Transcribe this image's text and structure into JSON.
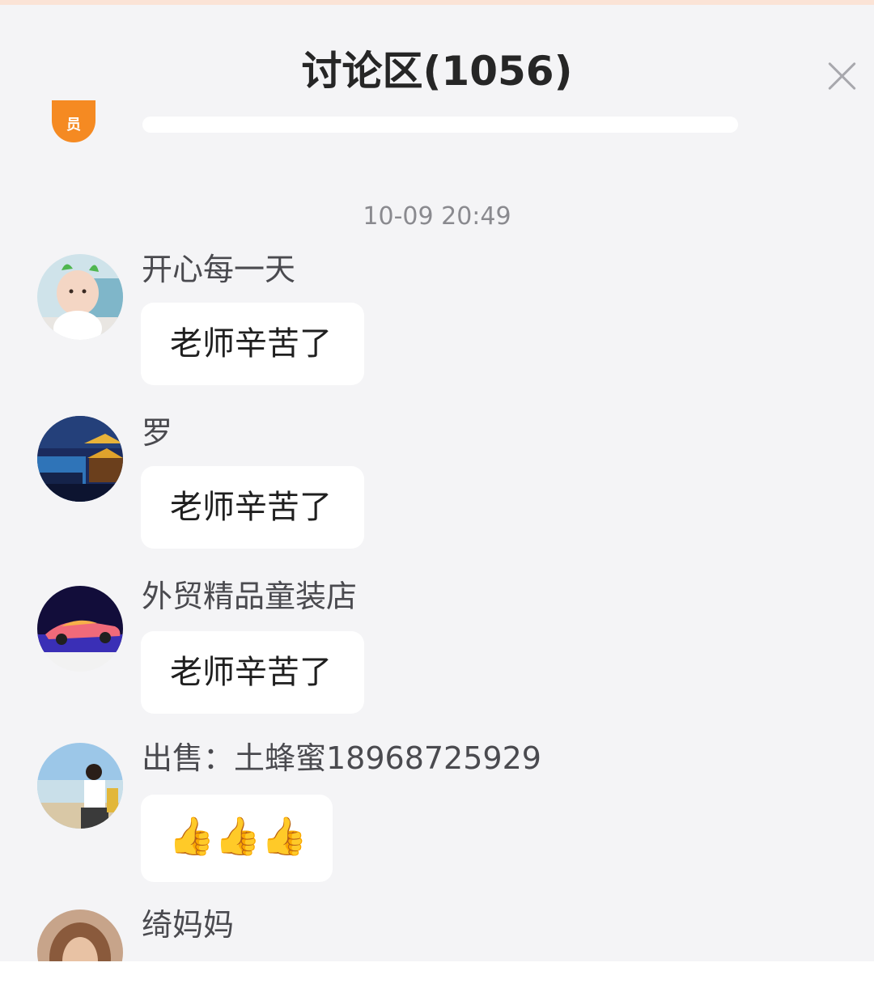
{
  "header": {
    "title": "讨论区(1056)",
    "close_icon": "close-icon"
  },
  "previous_message": {
    "avatar_text": "员"
  },
  "timestamp": "10-09 20:49",
  "messages": [
    {
      "username": "开心每一天",
      "text": "老师辛苦了",
      "avatar": "baby-photo-avatar"
    },
    {
      "username": "罗",
      "text": "老师辛苦了",
      "avatar": "night-pavilion-avatar"
    },
    {
      "username": "外贸精品童装店",
      "text": "老师辛苦了",
      "avatar": "sports-car-avatar"
    },
    {
      "username": "出售：土蜂蜜18968725929",
      "text": "👍👍👍",
      "avatar": "person-lakeside-avatar"
    },
    {
      "username": "绮妈妈",
      "text": "",
      "avatar": "partial-photo-avatar"
    }
  ],
  "colors": {
    "accent": "#f58a22",
    "background": "#f4f4f6",
    "bubble": "#ffffff"
  }
}
